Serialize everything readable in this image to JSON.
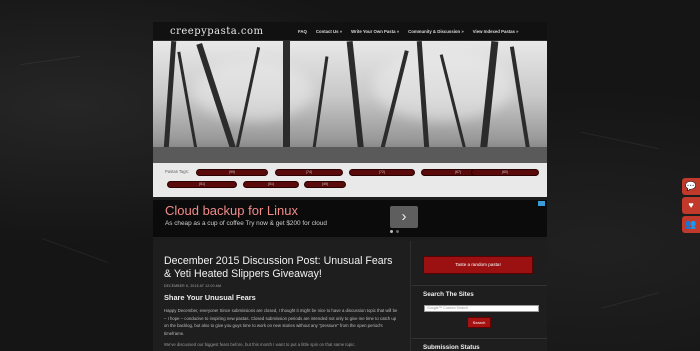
{
  "header": {
    "logo": "creepypasta.com",
    "nav": [
      {
        "label": "FAQ"
      },
      {
        "label": "Contact Us »"
      },
      {
        "label": "Write Your Own Pasta »"
      },
      {
        "label": "Community & Discussion »"
      },
      {
        "label": "View Indexed Pastas »"
      }
    ]
  },
  "tags": {
    "label": "Pastas Tags:",
    "items": [
      {
        "count": "(99)"
      },
      {
        "count": "(74)"
      },
      {
        "count": "(72)"
      },
      {
        "count": "(67)"
      },
      {
        "count": "(60)"
      },
      {
        "count": "(51)"
      },
      {
        "count": "(51)"
      },
      {
        "count": "(49)"
      }
    ]
  },
  "ad": {
    "title": "Cloud backup for Linux",
    "subtitle": "As cheap as a cup of coffee Try now & get $200 for cloud",
    "next_icon": "chevron-right-icon"
  },
  "post": {
    "title": "December 2015 Discussion Post: Unusual Fears & Yeti Heated Slippers Giveaway!",
    "date": "DECEMBER 6, 2015 AT 12:00 AM",
    "subheading": "Share Your Unusual Fears",
    "body": "Happy December, everyone! Since submissions are closed, I thought it might be nice to have a discussion topic that will be – I hope – conducive to inspiring new pastas. Closed submission periods are intended not only to give me time to catch up on the backlog, but also to give you guys time to work on new stories without any \"pressure\" from the open period's timeframe.",
    "more": "We've discussed our biggest fears before, but this month I want to put a little spin on that same topic."
  },
  "sidebar": {
    "random_button": "Taste a random pasta!",
    "search_heading": "Search The Sites",
    "search_placeholder": "Google™ Custom Search",
    "search_button": "Search",
    "status_heading": "Submission Status"
  },
  "floating": [
    {
      "icon": "chat-icon",
      "glyph": "💬"
    },
    {
      "icon": "heart-icon",
      "glyph": "♥"
    },
    {
      "icon": "group-icon",
      "glyph": "👥"
    }
  ],
  "colors": {
    "accent": "#9b1111",
    "tag_bg": "#5a0a0a",
    "float_btn": "#c0392b"
  }
}
